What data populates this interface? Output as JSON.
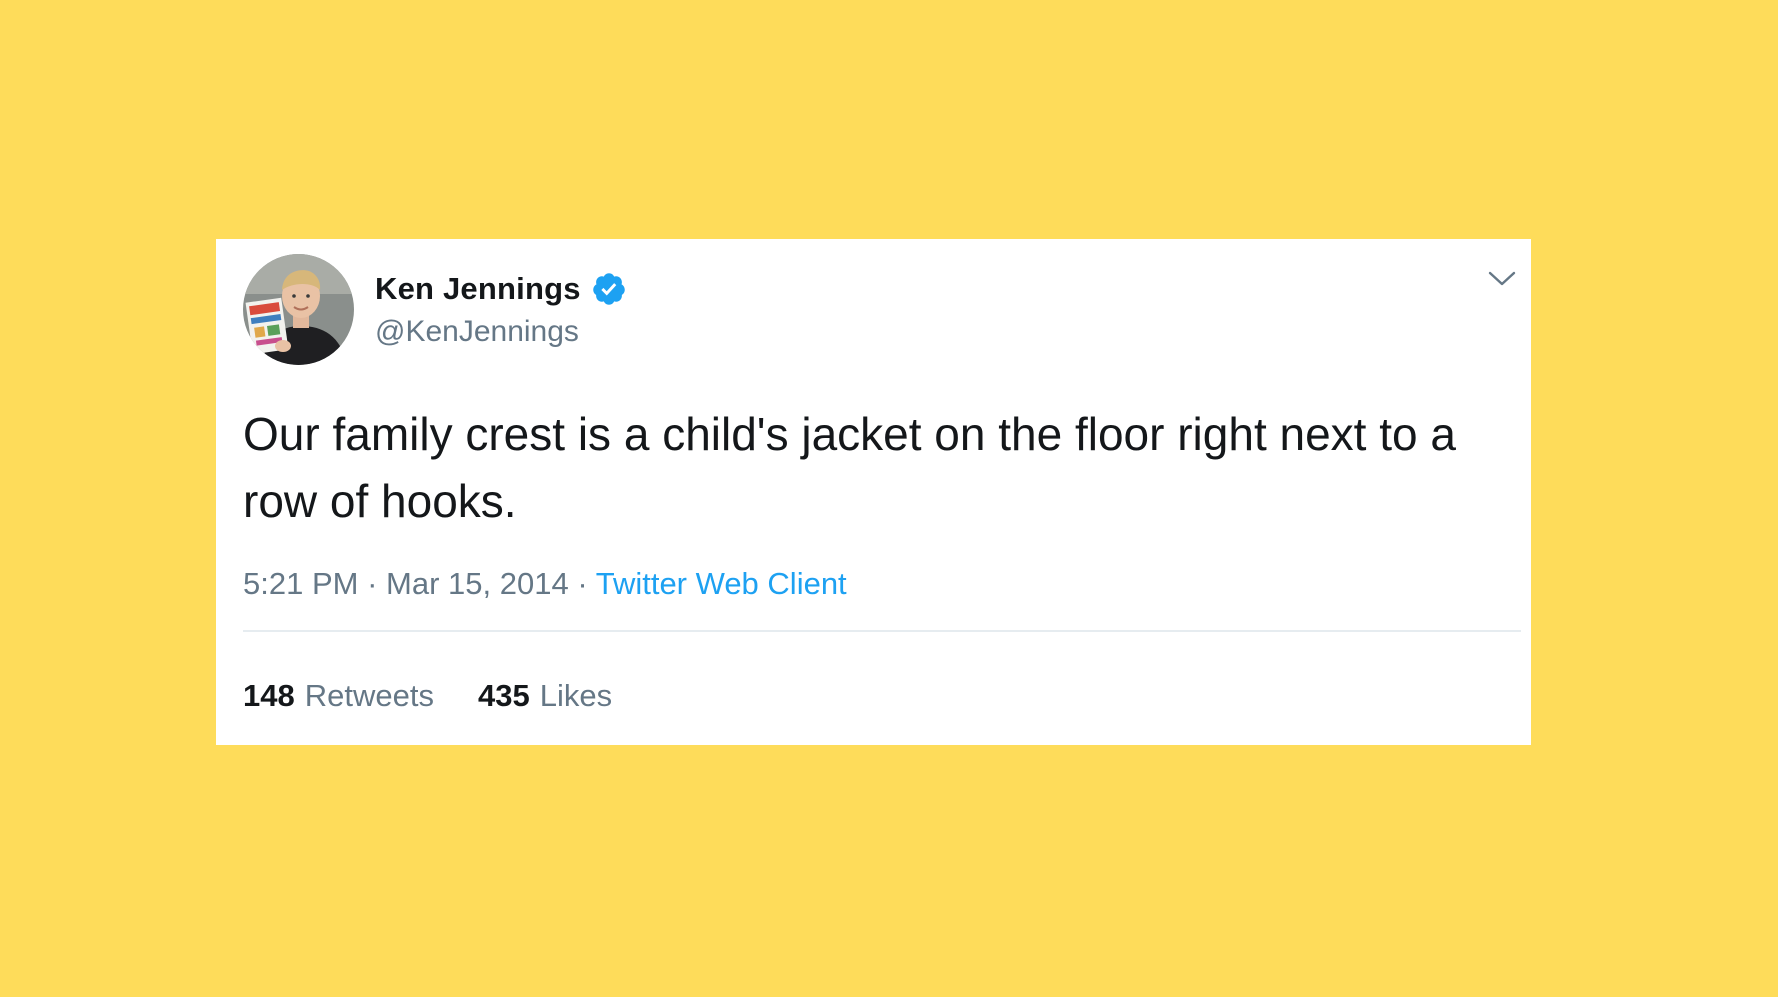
{
  "colors": {
    "background": "#FEDC5A",
    "card": "#FFFFFF",
    "text_primary": "#14171A",
    "text_secondary": "#657786",
    "link": "#1DA1F2",
    "verified": "#1DA1F2"
  },
  "tweet": {
    "author": {
      "display_name": "Ken Jennings",
      "handle": "@KenJennings",
      "verified": true,
      "avatar_icon": "profile-photo"
    },
    "text": "Our family crest is a child's jacket on the floor right next to a row of hooks.",
    "meta": {
      "time": "5:21 PM",
      "separator": "·",
      "date": "Mar 15, 2014",
      "source": "Twitter Web Client"
    },
    "stats": {
      "retweets_count": "148",
      "retweets_label": "Retweets",
      "likes_count": "435",
      "likes_label": "Likes"
    },
    "menu_icon": "chevron-down-icon"
  }
}
